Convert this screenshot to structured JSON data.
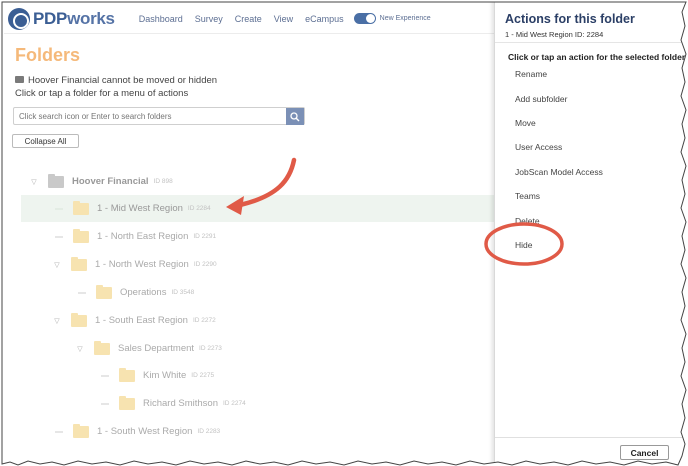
{
  "logo": {
    "prefix": "PDP",
    "suffix": "works"
  },
  "nav": {
    "links": [
      "Dashboard",
      "Survey",
      "Create",
      "View",
      "eCampus"
    ],
    "toggle_label": "New Experience"
  },
  "main": {
    "title": "Folders",
    "note_line1": "Hoover Financial cannot be moved or hidden",
    "note_line2": "Click or tap a folder for a menu of actions",
    "search_placeholder": "Click search icon or Enter to search folders",
    "collapse_label": "Collapse All"
  },
  "tree": [
    {
      "name": "Hoover Financial",
      "id": "ID 898"
    },
    {
      "name": "1 - Mid West Region",
      "id": "ID 2284"
    },
    {
      "name": "1 - North East Region",
      "id": "ID 2291"
    },
    {
      "name": "1 - North West Region",
      "id": "ID 2290"
    },
    {
      "name": "Operations",
      "id": "ID 3548"
    },
    {
      "name": "1 - South East Region",
      "id": "ID 2272"
    },
    {
      "name": "Sales Department",
      "id": "ID 2273"
    },
    {
      "name": "Kim White",
      "id": "ID 2275"
    },
    {
      "name": "Richard Smithson",
      "id": "ID 2274"
    },
    {
      "name": "1 - South West Region",
      "id": "ID 2283"
    }
  ],
  "panel": {
    "title": "Actions for this folder",
    "subtitle": "1 - Mid West Region ID: 2284",
    "hint": "Click or tap an action for the selected folder.",
    "actions": [
      "Rename",
      "Add subfolder",
      "Move",
      "User Access",
      "JobScan Model Access",
      "Teams",
      "Delete",
      "Hide"
    ],
    "cancel_label": "Cancel"
  },
  "colors": {
    "accent": "#3b5e94",
    "title_orange": "#f5b97a",
    "annotation_red": "#e05a47"
  },
  "icons": [
    "logo-mark-icon",
    "search-icon",
    "folder-icon",
    "caret-down-icon"
  ]
}
